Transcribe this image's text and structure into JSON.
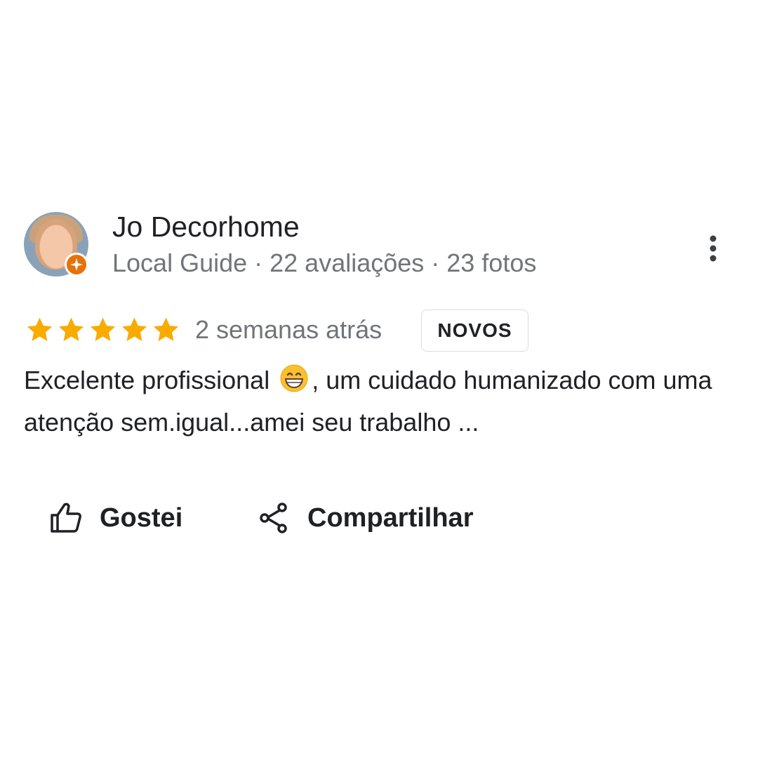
{
  "reviewer": {
    "name": "Jo Decorhome",
    "meta": "Local Guide · 22 avaliações · 23 fotos"
  },
  "rating": {
    "stars": 5,
    "max": 5,
    "star_color": "#f9ab00",
    "time": "2 semanas atrás",
    "badge": "NOVOS"
  },
  "review": {
    "text_before_emoji": "Excelente profissional",
    "text_after_emoji": ", um cuidado humanizado com uma atenção sem.igual...amei seu trabalho ..."
  },
  "actions": {
    "like_label": "Gostei",
    "share_label": "Compartilhar"
  },
  "icons": {
    "local_guide_badge": "local-guide-badge-icon",
    "more": "more-vert-icon",
    "like": "thumb-up-icon",
    "share": "share-icon",
    "emoji": "grinning-face-emoji"
  },
  "colors": {
    "text_primary": "#202124",
    "text_secondary": "#70757a",
    "local_guide_orange": "#e8710a",
    "badge_border": "#dadce0"
  }
}
